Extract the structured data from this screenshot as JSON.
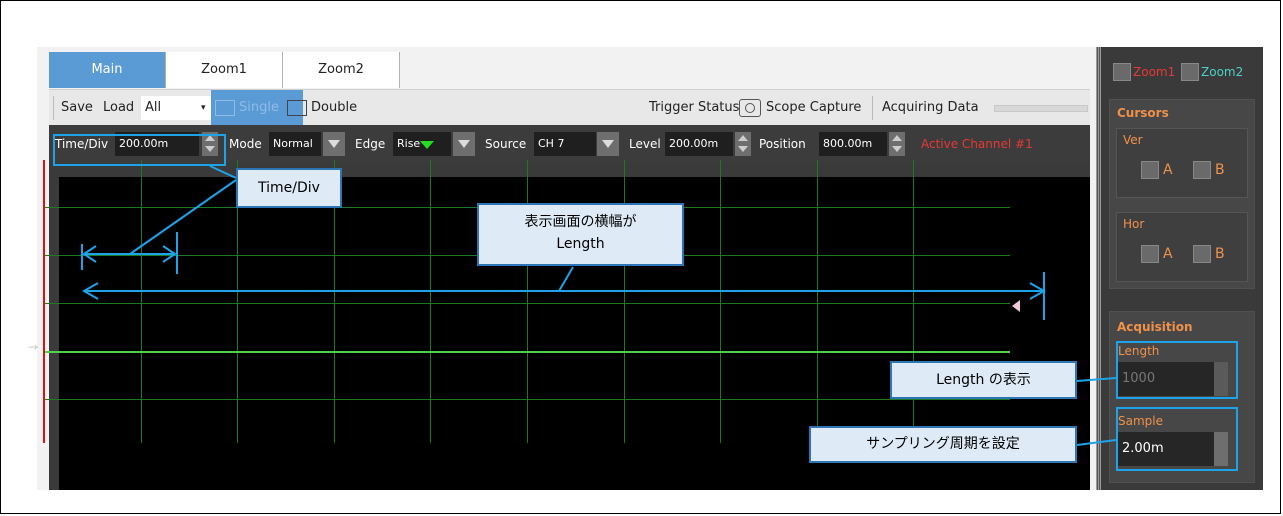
{
  "tabs": [
    {
      "label": "Main",
      "active": true
    },
    {
      "label": "Zoom1",
      "active": false
    },
    {
      "label": "Zoom2",
      "active": false
    }
  ],
  "toolbar": {
    "save": "Save",
    "load": "Load",
    "channel_select": "All",
    "single": "Single",
    "double": "Double",
    "trigger_status": "Trigger Status",
    "scope_capture": "Scope Capture",
    "acquiring": "Acquiring Data"
  },
  "params": {
    "timediv_label": "Time/Div",
    "timediv_value": "200.00m",
    "mode_label": "Mode",
    "mode_value": "Normal",
    "edge_label": "Edge",
    "edge_value": "Rise",
    "source_label": "Source",
    "source_value": "CH 7",
    "level_label": "Level",
    "level_value": "200.00m",
    "position_label": "Position",
    "position_value": "800.00m",
    "active_channel": "Active Channel #1"
  },
  "scope": {
    "trace_color": "#4bd34b",
    "grid_color": "#1c7a22",
    "trigger_marker_color": "#22dd22"
  },
  "right_panel": {
    "zoom1": "Zoom1",
    "zoom2": "Zoom2",
    "cursors_title": "Cursors",
    "ver_label": "Ver",
    "hor_label": "Hor",
    "cursor_a": "A",
    "cursor_b": "B",
    "acquisition_title": "Acquisition",
    "length_label": "Length",
    "length_value": "1000",
    "sample_label": "Sample",
    "sample_value": "2.00m"
  },
  "annotations": {
    "timediv": "Time/Div",
    "length_line1": "表示画面の横幅が",
    "length_line2": "Length",
    "length_display": "Length の表示",
    "sampling": "サンプリング周期を設定"
  },
  "colors": {
    "tab_active": "#5b9bd5",
    "callout_fill": "#deebf7",
    "callout_border": "#2e75b6",
    "highlight": "#1ea3e8",
    "active_channel": "#e53935",
    "section_title": "#f0914a"
  }
}
